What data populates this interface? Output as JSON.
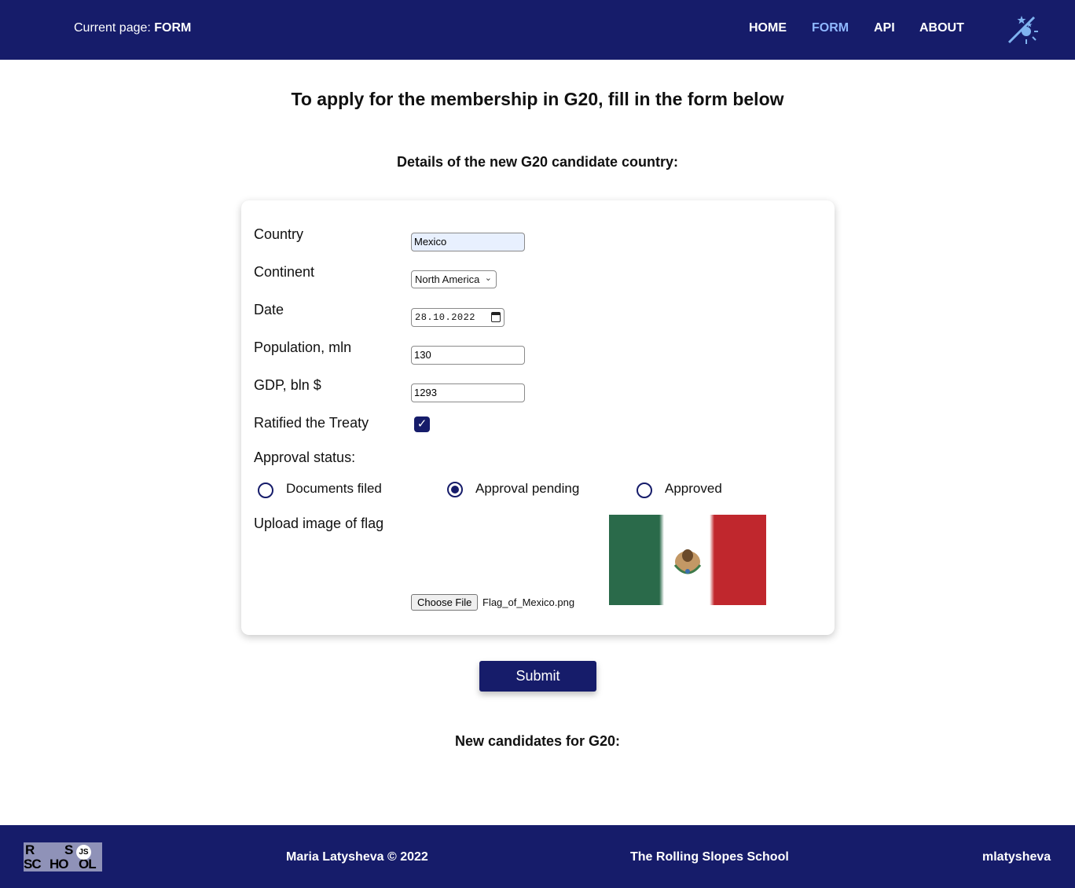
{
  "header": {
    "current_page_label": "Current page: ",
    "current_page_value": "FORM",
    "nav": [
      {
        "label": "HOME"
      },
      {
        "label": "FORM"
      },
      {
        "label": "API"
      },
      {
        "label": "ABOUT"
      }
    ],
    "active_nav": "FORM",
    "theme_toggle_icon": "moon-sun-icon"
  },
  "main": {
    "title": "To apply for the membership in G20, fill in the form below",
    "form_section_title": "Details of the new G20 candidate country:",
    "candidates_title": "New candidates for G20:"
  },
  "form": {
    "country": {
      "label": "Country",
      "value": "Mexico"
    },
    "continent": {
      "label": "Continent",
      "value": "North America"
    },
    "date": {
      "label": "Date",
      "value": "28.10.2022"
    },
    "population": {
      "label": "Population, mln",
      "value": "130"
    },
    "gdp": {
      "label": "GDP, bln $",
      "value": "1293"
    },
    "ratified": {
      "label": "Ratified the Treaty",
      "checked": true,
      "check_glyph": "✓"
    },
    "approval": {
      "label": "Approval status:",
      "options": [
        {
          "label": "Documents filed",
          "checked": false
        },
        {
          "label": "Approval pending",
          "checked": true
        },
        {
          "label": "Approved",
          "checked": false
        }
      ]
    },
    "flag": {
      "label": "Upload image of flag",
      "button_label": "Choose File",
      "file_name": "Flag_of_Mexico.png",
      "colors": {
        "green": "#2a6a4a",
        "white": "#ffffff",
        "red": "#c0272d"
      }
    },
    "submit_label": "Submit"
  },
  "footer": {
    "author": "Maria Latysheva © 2022",
    "school": "The Rolling Slopes School",
    "github": "mlatysheva",
    "logo_letters": [
      "R",
      "S",
      "SC",
      "HO",
      "OL"
    ],
    "logo_badge": "JS"
  },
  "colors": {
    "primary": "#161c6a",
    "active_nav": "#8fb8ff",
    "autofill": "#e8f0fe"
  }
}
